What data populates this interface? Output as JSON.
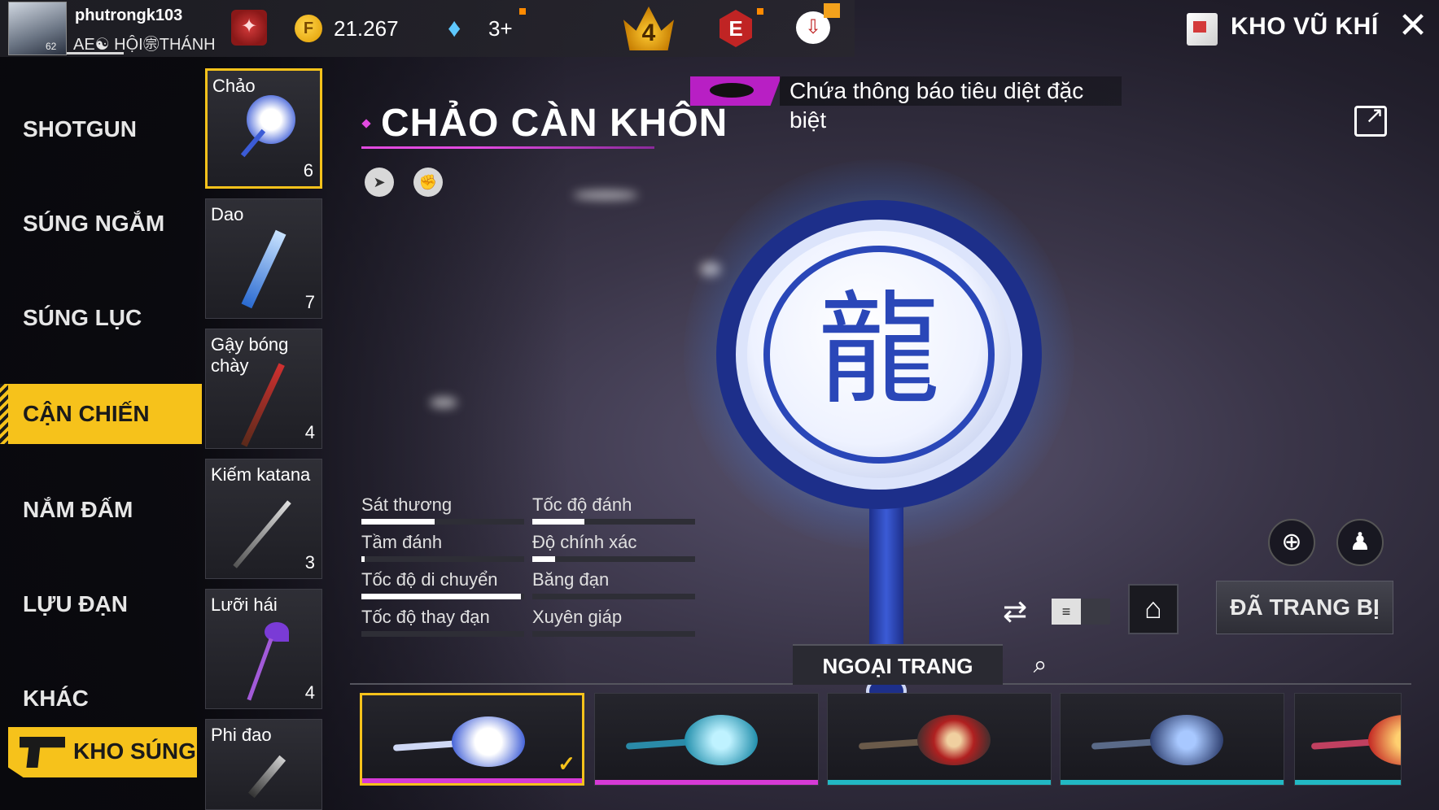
{
  "player": {
    "name": "phutrongk103",
    "guild": "AE☯ HỘI㊪THÁNH",
    "level": "62"
  },
  "currency": {
    "gold_icon": "F",
    "gold": "21.267",
    "diamonds": "3+"
  },
  "header": {
    "title": "KHO VŨ KHÍ",
    "crown_level": "4",
    "elite_label": "E"
  },
  "categories": [
    {
      "label": "SHOTGUN"
    },
    {
      "label": "SÚNG NGẮM"
    },
    {
      "label": "SÚNG LỤC"
    },
    {
      "label": "CẬN CHIẾN"
    },
    {
      "label": "NẮM ĐẤM"
    },
    {
      "label": "LỰU ĐẠN"
    },
    {
      "label": "KHÁC"
    }
  ],
  "active_category": "CẬN CHIẾN",
  "armory_button": "KHO SÚNG",
  "weapons": [
    {
      "name": "Chảo",
      "count": "6"
    },
    {
      "name": "Dao",
      "count": "7"
    },
    {
      "name": "Gậy bóng chày",
      "count": "4"
    },
    {
      "name": "Kiếm katana",
      "count": "3"
    },
    {
      "name": "Lưỡi hái",
      "count": "4"
    },
    {
      "name": "Phi đao",
      "count": ""
    }
  ],
  "selected_weapon": {
    "title": "CHẢO CÀN KHÔN",
    "notice": "Chứa thông báo tiêu diệt đặc biệt"
  },
  "stats": [
    {
      "label": "Sát thương",
      "level": 0.45
    },
    {
      "label": "Tốc độ đánh",
      "level": 0.32
    },
    {
      "label": "Tầm đánh",
      "level": 0.02
    },
    {
      "label": "Độ chính xác",
      "level": 0.14
    },
    {
      "label": "Tốc độ di chuyển",
      "level": 0.98
    },
    {
      "label": "Băng đạn",
      "level": 0.0
    },
    {
      "label": "Tốc độ thay đạn",
      "level": 0.0
    },
    {
      "label": "Xuyên giáp",
      "level": 0.0
    }
  ],
  "controls": {
    "equipped_label": "ĐÃ TRANG BỊ",
    "skins_tab": "NGOẠI TRANG",
    "list_toggle": "≡"
  },
  "skins": [
    {
      "theme": "blue-white dragon",
      "bar_color": "#d63ad6",
      "selected": true
    },
    {
      "theme": "teal snowflake",
      "bar_color": "#d63ad6",
      "selected": false
    },
    {
      "theme": "red emblem",
      "bar_color": "#22b8c4",
      "selected": false
    },
    {
      "theme": "lightning blue",
      "bar_color": "#22b8c4",
      "selected": false
    },
    {
      "theme": "red-gold",
      "bar_color": "#22b8c4",
      "selected": false
    }
  ],
  "colors": {
    "accent_yellow": "#f6c21b",
    "accent_magenta": "#e24ae0",
    "pan_blue": "#2a47b8"
  }
}
